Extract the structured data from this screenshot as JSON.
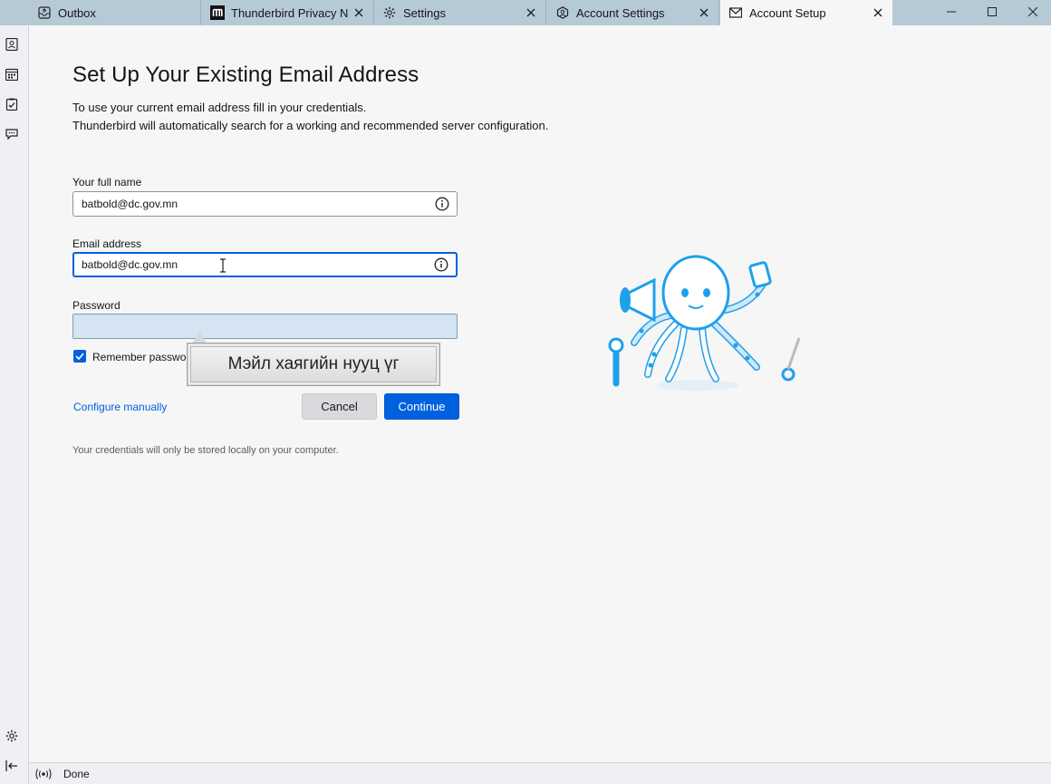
{
  "tabs": [
    {
      "label": "Outbox",
      "icon": "outbox-icon"
    },
    {
      "label": "Thunderbird Privacy Not",
      "icon": "mozilla-m-icon"
    },
    {
      "label": "Settings",
      "icon": "gear-icon"
    },
    {
      "label": "Account Settings",
      "icon": "account-settings-icon"
    },
    {
      "label": "Account Setup",
      "icon": "mail-setup-icon"
    }
  ],
  "page": {
    "title": "Set Up Your Existing Email Address",
    "intro_line1": "To use your current email address fill in your credentials.",
    "intro_line2": "Thunderbird will automatically search for a working and recommended server configuration."
  },
  "form": {
    "fullname_label": "Your full name",
    "fullname_value": "batbold@dc.gov.mn",
    "email_label": "Email address",
    "email_value": "batbold@dc.gov.mn",
    "password_label": "Password",
    "password_value": "",
    "remember_label": "Remember password",
    "remember_checked": true,
    "tooltip_text": "Мэйл хаягийн нууц үг"
  },
  "actions": {
    "configure_manually": "Configure manually",
    "cancel": "Cancel",
    "continue": "Continue"
  },
  "footnote": "Your credentials will only be stored locally on your computer.",
  "status": {
    "text": "Done"
  },
  "colors": {
    "accent": "#0060df",
    "tabbar": "#b6cad5",
    "illustration": "#1ea0ec"
  }
}
